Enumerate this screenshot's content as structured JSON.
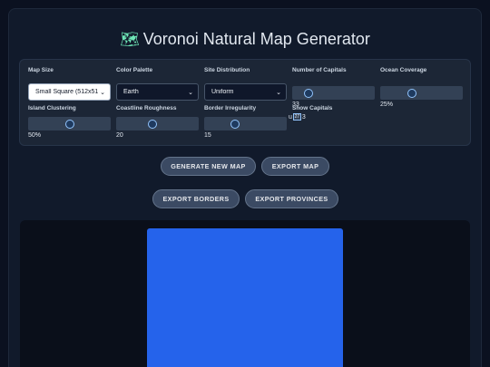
{
  "title": {
    "icon": "map-icon",
    "icon_glyph": "🗺",
    "text": "Voronoi Natural Map Generator"
  },
  "controls": {
    "map_size": {
      "label": "Map Size",
      "value": "Small Square (512x512"
    },
    "color_palette": {
      "label": "Color Palette",
      "value": "Earth"
    },
    "site_distribution": {
      "label": "Site Distribution",
      "value": "Uniform"
    },
    "number_of_capitals": {
      "label": "Number of Capitals",
      "value": "33",
      "fraction": 0.2
    },
    "ocean_coverage": {
      "label": "Ocean Coverage",
      "value": "25%",
      "fraction": 0.38
    },
    "island_clustering": {
      "label": "Island Clustering",
      "value": "50%",
      "fraction": 0.5
    },
    "coastline_roughness": {
      "label": "Coastline Roughness",
      "value": "20",
      "fraction": 0.44
    },
    "border_irregularity": {
      "label": "Border Irregularity",
      "value": "15",
      "fraction": 0.37
    },
    "show_capitals": {
      "label": "Show Capitals",
      "prefix": "u",
      "box": "27",
      "suffix": "3"
    }
  },
  "buttons": {
    "generate": "GENERATE NEW MAP",
    "export_map": "EXPORT MAP",
    "export_borders": "EXPORT BORDERS",
    "export_provinces": "EXPORT PROVINCES"
  },
  "colors": {
    "background": "#0b1120",
    "panel": "#1c2636",
    "map_ocean": "#2563eb",
    "button": "#3b4a63"
  }
}
